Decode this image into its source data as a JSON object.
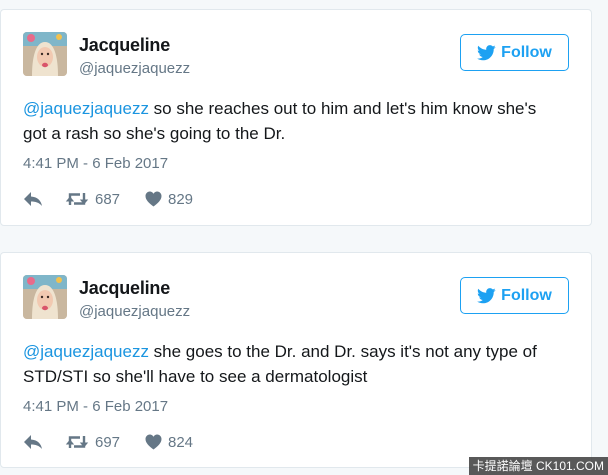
{
  "colors": {
    "accent": "#1da1f2",
    "mention": "#1b95e0",
    "text": "#14171a",
    "muted": "#657786",
    "background": "#f5f8fa"
  },
  "icons": {
    "follow": "twitter-bird-icon",
    "reply": "reply-arrow-icon",
    "retweet": "retweet-icon",
    "like": "heart-icon"
  },
  "tweets": [
    {
      "display_name": "Jacqueline",
      "handle": "@jaquezjaquezz",
      "follow_label": "Follow",
      "mention": "@jaquezjaquezz",
      "body": " so she reaches out to him and let's him know she's got a rash so she's going to the Dr.",
      "timestamp": "4:41 PM - 6 Feb 2017",
      "retweets": "687",
      "likes": "829"
    },
    {
      "display_name": "Jacqueline",
      "handle": "@jaquezjaquezz",
      "follow_label": "Follow",
      "mention": "@jaquezjaquezz",
      "body": " she goes to the Dr. and Dr. says it's not any type of STD/STI so she'll have to see a dermatologist",
      "timestamp": "4:41 PM - 6 Feb 2017",
      "retweets": "697",
      "likes": "824"
    }
  ],
  "watermark": "卡提諾論壇 CK101.COM"
}
